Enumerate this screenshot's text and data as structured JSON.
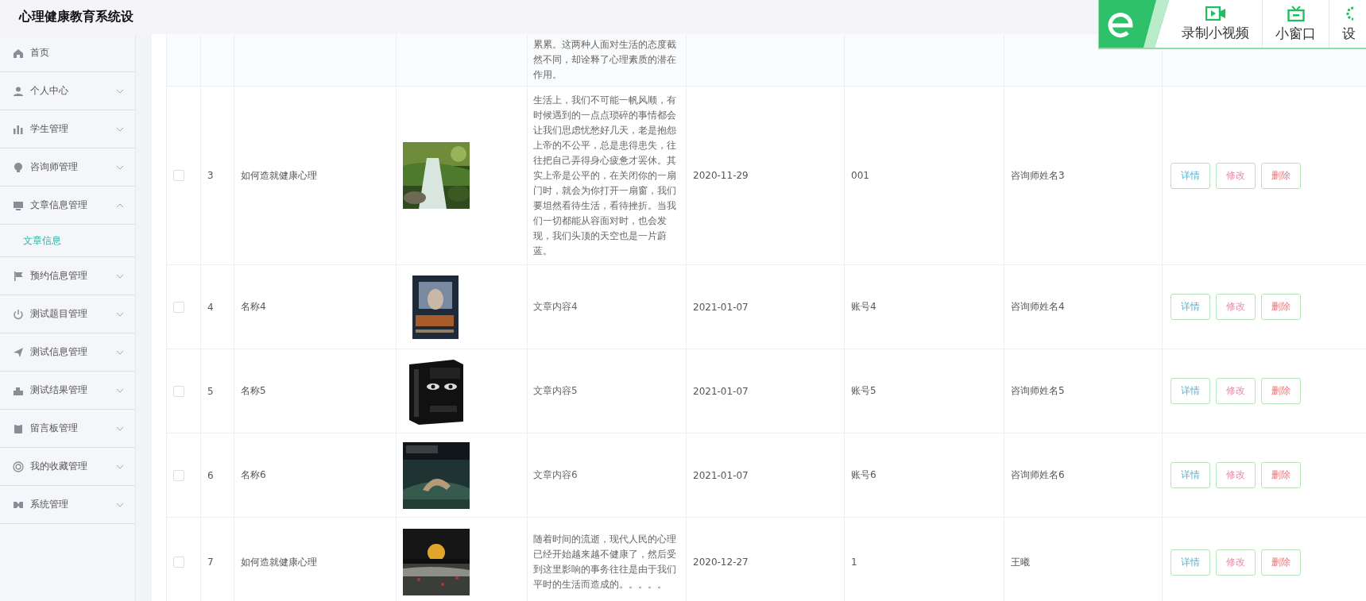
{
  "app_title": "心理健康教育系统设",
  "sidebar": {
    "items": [
      {
        "label": "首页",
        "expandable": false
      },
      {
        "label": "个人中心",
        "expandable": true,
        "expanded": false
      },
      {
        "label": "学生管理",
        "expandable": true,
        "expanded": false
      },
      {
        "label": "咨询师管理",
        "expandable": true,
        "expanded": false
      },
      {
        "label": "文章信息管理",
        "expandable": true,
        "expanded": true,
        "children": [
          {
            "label": "文章信息",
            "selected": true
          }
        ]
      },
      {
        "label": "预约信息管理",
        "expandable": true,
        "expanded": false
      },
      {
        "label": "测试题目管理",
        "expandable": true,
        "expanded": false
      },
      {
        "label": "测试信息管理",
        "expandable": true,
        "expanded": false
      },
      {
        "label": "测试结果管理",
        "expandable": true,
        "expanded": false
      },
      {
        "label": "留言板管理",
        "expandable": true,
        "expanded": false
      },
      {
        "label": "我的收藏管理",
        "expandable": true,
        "expanded": false
      },
      {
        "label": "系统管理",
        "expandable": true,
        "expanded": false
      }
    ]
  },
  "table": {
    "rows": [
      {
        "content": "累累。这两种人面对生活的态度截然不同，却诠释了心理素质的潜在作用。"
      },
      {
        "checked": false,
        "index": "3",
        "name": "如何造就健康心理",
        "content": "生活上，我们不可能一帆风顺，有时候遇到的一点点琐碎的事情都会让我们思虑忧愁好几天，老是抱怨上帝的不公平，总是患得患失，往往把自己弄得身心疲惫才罢休。其实上帝是公平的，在关闭你的一扇门时，就会为你打开一扇窗，我们要坦然看待生活，看待挫折。当我们一切都能从容面对时，也会发现，我们头顶的天空也是一片蔚蓝。",
        "date": "2020-11-29",
        "account": "001",
        "consultant": "咨询师姓名3",
        "actions": [
          {
            "kind": "detail",
            "label": "详情"
          },
          {
            "kind": "edit",
            "label": "修改"
          },
          {
            "kind": "delete",
            "label": "删除"
          }
        ]
      },
      {
        "checked": false,
        "index": "4",
        "name": "名称4",
        "content": "文章内容4",
        "date": "2021-01-07",
        "account": "账号4",
        "consultant": "咨询师姓名4",
        "actions": [
          {
            "kind": "detail",
            "label": "详情"
          },
          {
            "kind": "edit",
            "label": "修改"
          },
          {
            "kind": "delete",
            "label": "删除"
          }
        ]
      },
      {
        "checked": false,
        "index": "5",
        "name": "名称5",
        "content": "文章内容5",
        "date": "2021-01-07",
        "account": "账号5",
        "consultant": "咨询师姓名5",
        "actions": [
          {
            "kind": "detail",
            "label": "详情"
          },
          {
            "kind": "edit",
            "label": "修改"
          },
          {
            "kind": "delete",
            "label": "删除"
          }
        ]
      },
      {
        "checked": false,
        "index": "6",
        "name": "名称6",
        "content": "文章内容6",
        "date": "2021-01-07",
        "account": "账号6",
        "consultant": "咨询师姓名6",
        "actions": [
          {
            "kind": "detail",
            "label": "详情"
          },
          {
            "kind": "edit",
            "label": "修改"
          },
          {
            "kind": "delete",
            "label": "删除"
          }
        ]
      },
      {
        "checked": false,
        "index": "7",
        "name": "如何造就健康心理",
        "content": "随着时间的流逝，现代人民的心理已经开始越来越不健康了，然后受到这里影响的事务往往是由于我们平时的生活而造成的。。。。。",
        "date": "2020-12-27",
        "account": "1",
        "consultant": "王曦",
        "actions": [
          {
            "kind": "detail",
            "label": "详情"
          },
          {
            "kind": "edit",
            "label": "修改"
          },
          {
            "kind": "delete",
            "label": "删除"
          }
        ]
      }
    ]
  },
  "recorder_toolbar": {
    "buttons": [
      {
        "kind": "record",
        "label": "录制小视频"
      },
      {
        "kind": "window",
        "label": "小窗口"
      },
      {
        "kind": "settings",
        "label": "设"
      }
    ]
  }
}
